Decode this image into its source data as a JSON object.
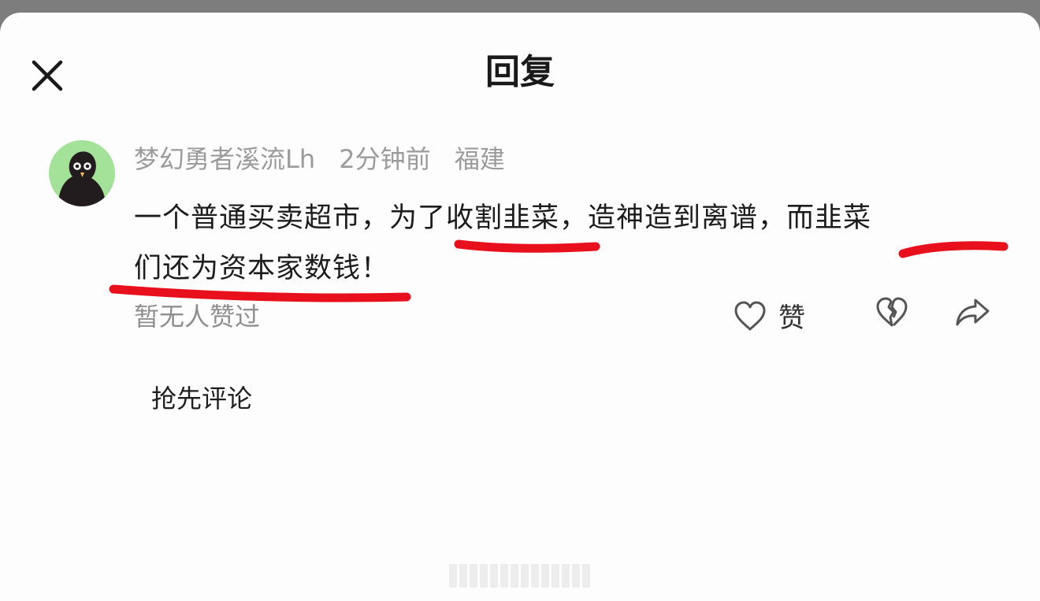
{
  "header": {
    "title": "回复",
    "close_icon": "close-icon"
  },
  "comment": {
    "author": "梦幻勇者溪流Lh",
    "time": "2分钟前",
    "location": "福建",
    "text_line1": "一个普通买卖超市，为了收割韭菜，造神造到离谱，而韭菜",
    "text_line2": "们还为资本家数钱！",
    "annotation_color": "#e8101c",
    "avatar_bg": "#a4e29a"
  },
  "actions": {
    "likes_status": "暂无人赞过",
    "like_label": "赞",
    "like_icon": "heart-icon",
    "dislike_icon": "broken-heart-icon",
    "share_icon": "share-arrow-icon"
  },
  "reply_prompt": "抢先评论"
}
